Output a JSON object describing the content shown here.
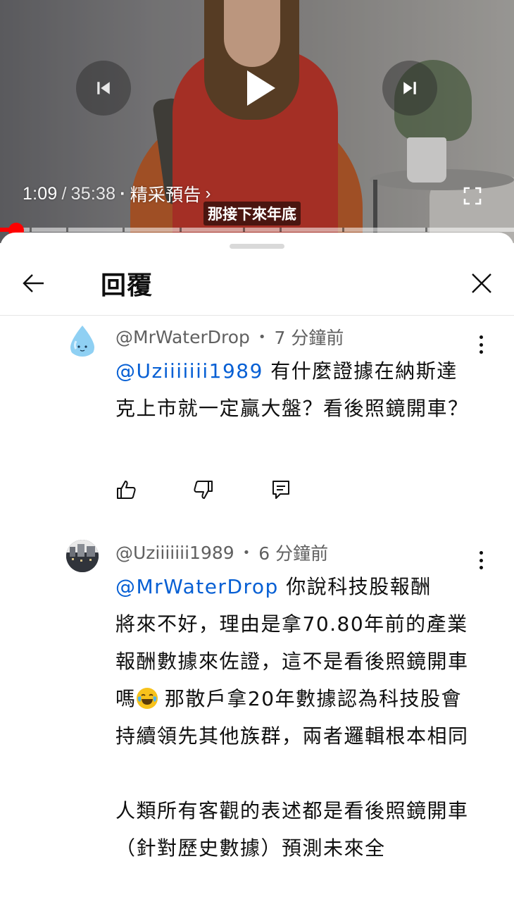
{
  "player": {
    "current_time": "1:09",
    "separator": "/",
    "duration": "35:38",
    "chapter_dot": "·",
    "chapter_title": "精采預告",
    "chapter_chevron": "›",
    "subtitle": "那接下來年底",
    "progress_fraction": 0.032,
    "accent_color": "#ff0000",
    "icons": [
      "previous-icon",
      "play-icon",
      "next-icon",
      "fullscreen-icon"
    ]
  },
  "sheet": {
    "title": "回覆",
    "back_icon": "arrow-left-icon",
    "close_icon": "close-icon"
  },
  "comments": [
    {
      "author": "@MrWaterDrop",
      "bullet": "•",
      "time": "7 分鐘前",
      "avatar": "water-drop-avatar",
      "mention": "@Uziiiiiii1989",
      "text": " 有什麼證據在納斯達克上市就一定贏大盤？看後照鏡開車？",
      "actions": [
        "like-icon",
        "dislike-icon",
        "reply-icon"
      ]
    },
    {
      "author": "@Uziiiiiii1989",
      "bullet": "•",
      "time": "6 分鐘前",
      "avatar": "city-avatar",
      "mention": "@MrWaterDrop",
      "line1": "  你說科技股報酬",
      "text_part_1": "將來不好，理由是拿70.80年前的產業報酬數據來佐證，這不是看後照鏡開車嗎",
      "emoji": "face-with-tears-of-joy",
      "text_part_2": " 那散戶拿20年數據認為科技股會持續領先其他族群，兩者邏輯根本相同",
      "paragraph_2": "人類所有客觀的表述都是看後照鏡開車（針對歷史數據）預測未來全"
    }
  ]
}
